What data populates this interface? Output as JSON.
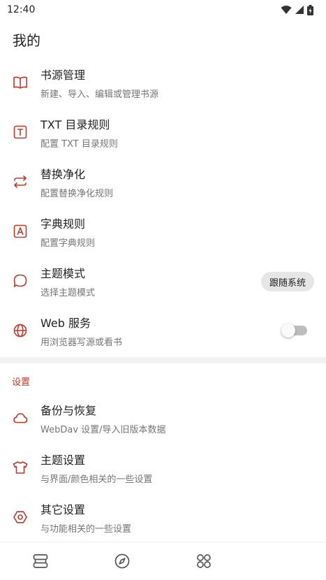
{
  "status_bar": {
    "time": "12:40",
    "icons": [
      "wifi-icon",
      "signal-icon",
      "battery-icon"
    ]
  },
  "page": {
    "title": "我的"
  },
  "colors": {
    "accent": "#C0392B",
    "text": "#222222",
    "subtext": "#757575"
  },
  "main_items": [
    {
      "icon": "book-icon",
      "title": "书源管理",
      "subtitle": "新建、导入、编辑或管理书源"
    },
    {
      "icon": "txt-icon",
      "title": "TXT 目录规则",
      "subtitle": "配置 TXT 目录规则"
    },
    {
      "icon": "replace-icon",
      "title": "替换净化",
      "subtitle": "配置替换净化规则"
    },
    {
      "icon": "dictionary-icon",
      "title": "字典规则",
      "subtitle": "配置字典规则"
    },
    {
      "icon": "theme-mode-icon",
      "title": "主题模式",
      "subtitle": "选择主题模式",
      "value": "跟随系统"
    },
    {
      "icon": "globe-icon",
      "title": "Web 服务",
      "subtitle": "用浏览器写源或看书",
      "enabled": false
    }
  ],
  "settings_section": {
    "label": "设置",
    "items": [
      {
        "icon": "cloud-icon",
        "title": "备份与恢复",
        "subtitle": "WebDav 设置/导入旧版本数据"
      },
      {
        "icon": "shirt-icon",
        "title": "主题设置",
        "subtitle": "与界面/颜色相关的一些设置"
      },
      {
        "icon": "settings-icon",
        "title": "其它设置",
        "subtitle": "与功能相关的一些设置"
      }
    ]
  },
  "bottom_nav": {
    "items": [
      "bookshelf-icon",
      "discover-icon",
      "rss-icon",
      "my-icon"
    ],
    "active_index": 3
  }
}
